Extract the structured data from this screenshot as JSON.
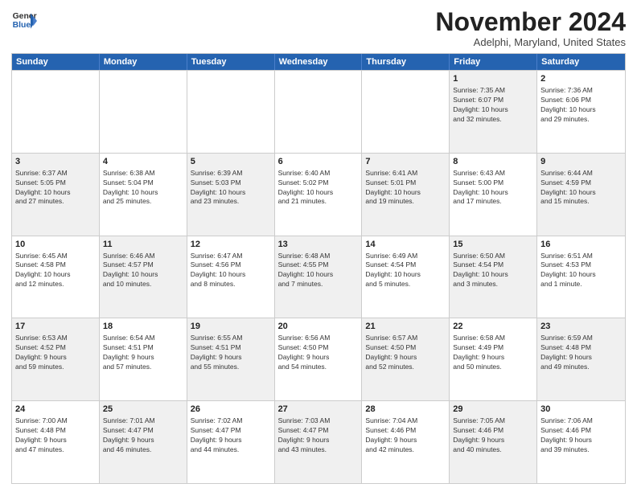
{
  "logo": {
    "general": "General",
    "blue": "Blue"
  },
  "header": {
    "month": "November 2024",
    "location": "Adelphi, Maryland, United States"
  },
  "weekdays": [
    "Sunday",
    "Monday",
    "Tuesday",
    "Wednesday",
    "Thursday",
    "Friday",
    "Saturday"
  ],
  "rows": [
    [
      {
        "day": "",
        "info": "",
        "shaded": false
      },
      {
        "day": "",
        "info": "",
        "shaded": false
      },
      {
        "day": "",
        "info": "",
        "shaded": false
      },
      {
        "day": "",
        "info": "",
        "shaded": false
      },
      {
        "day": "",
        "info": "",
        "shaded": false
      },
      {
        "day": "1",
        "info": "Sunrise: 7:35 AM\nSunset: 6:07 PM\nDaylight: 10 hours\nand 32 minutes.",
        "shaded": true
      },
      {
        "day": "2",
        "info": "Sunrise: 7:36 AM\nSunset: 6:06 PM\nDaylight: 10 hours\nand 29 minutes.",
        "shaded": false
      }
    ],
    [
      {
        "day": "3",
        "info": "Sunrise: 6:37 AM\nSunset: 5:05 PM\nDaylight: 10 hours\nand 27 minutes.",
        "shaded": true
      },
      {
        "day": "4",
        "info": "Sunrise: 6:38 AM\nSunset: 5:04 PM\nDaylight: 10 hours\nand 25 minutes.",
        "shaded": false
      },
      {
        "day": "5",
        "info": "Sunrise: 6:39 AM\nSunset: 5:03 PM\nDaylight: 10 hours\nand 23 minutes.",
        "shaded": true
      },
      {
        "day": "6",
        "info": "Sunrise: 6:40 AM\nSunset: 5:02 PM\nDaylight: 10 hours\nand 21 minutes.",
        "shaded": false
      },
      {
        "day": "7",
        "info": "Sunrise: 6:41 AM\nSunset: 5:01 PM\nDaylight: 10 hours\nand 19 minutes.",
        "shaded": true
      },
      {
        "day": "8",
        "info": "Sunrise: 6:43 AM\nSunset: 5:00 PM\nDaylight: 10 hours\nand 17 minutes.",
        "shaded": false
      },
      {
        "day": "9",
        "info": "Sunrise: 6:44 AM\nSunset: 4:59 PM\nDaylight: 10 hours\nand 15 minutes.",
        "shaded": true
      }
    ],
    [
      {
        "day": "10",
        "info": "Sunrise: 6:45 AM\nSunset: 4:58 PM\nDaylight: 10 hours\nand 12 minutes.",
        "shaded": false
      },
      {
        "day": "11",
        "info": "Sunrise: 6:46 AM\nSunset: 4:57 PM\nDaylight: 10 hours\nand 10 minutes.",
        "shaded": true
      },
      {
        "day": "12",
        "info": "Sunrise: 6:47 AM\nSunset: 4:56 PM\nDaylight: 10 hours\nand 8 minutes.",
        "shaded": false
      },
      {
        "day": "13",
        "info": "Sunrise: 6:48 AM\nSunset: 4:55 PM\nDaylight: 10 hours\nand 7 minutes.",
        "shaded": true
      },
      {
        "day": "14",
        "info": "Sunrise: 6:49 AM\nSunset: 4:54 PM\nDaylight: 10 hours\nand 5 minutes.",
        "shaded": false
      },
      {
        "day": "15",
        "info": "Sunrise: 6:50 AM\nSunset: 4:54 PM\nDaylight: 10 hours\nand 3 minutes.",
        "shaded": true
      },
      {
        "day": "16",
        "info": "Sunrise: 6:51 AM\nSunset: 4:53 PM\nDaylight: 10 hours\nand 1 minute.",
        "shaded": false
      }
    ],
    [
      {
        "day": "17",
        "info": "Sunrise: 6:53 AM\nSunset: 4:52 PM\nDaylight: 9 hours\nand 59 minutes.",
        "shaded": true
      },
      {
        "day": "18",
        "info": "Sunrise: 6:54 AM\nSunset: 4:51 PM\nDaylight: 9 hours\nand 57 minutes.",
        "shaded": false
      },
      {
        "day": "19",
        "info": "Sunrise: 6:55 AM\nSunset: 4:51 PM\nDaylight: 9 hours\nand 55 minutes.",
        "shaded": true
      },
      {
        "day": "20",
        "info": "Sunrise: 6:56 AM\nSunset: 4:50 PM\nDaylight: 9 hours\nand 54 minutes.",
        "shaded": false
      },
      {
        "day": "21",
        "info": "Sunrise: 6:57 AM\nSunset: 4:50 PM\nDaylight: 9 hours\nand 52 minutes.",
        "shaded": true
      },
      {
        "day": "22",
        "info": "Sunrise: 6:58 AM\nSunset: 4:49 PM\nDaylight: 9 hours\nand 50 minutes.",
        "shaded": false
      },
      {
        "day": "23",
        "info": "Sunrise: 6:59 AM\nSunset: 4:48 PM\nDaylight: 9 hours\nand 49 minutes.",
        "shaded": true
      }
    ],
    [
      {
        "day": "24",
        "info": "Sunrise: 7:00 AM\nSunset: 4:48 PM\nDaylight: 9 hours\nand 47 minutes.",
        "shaded": false
      },
      {
        "day": "25",
        "info": "Sunrise: 7:01 AM\nSunset: 4:47 PM\nDaylight: 9 hours\nand 46 minutes.",
        "shaded": true
      },
      {
        "day": "26",
        "info": "Sunrise: 7:02 AM\nSunset: 4:47 PM\nDaylight: 9 hours\nand 44 minutes.",
        "shaded": false
      },
      {
        "day": "27",
        "info": "Sunrise: 7:03 AM\nSunset: 4:47 PM\nDaylight: 9 hours\nand 43 minutes.",
        "shaded": true
      },
      {
        "day": "28",
        "info": "Sunrise: 7:04 AM\nSunset: 4:46 PM\nDaylight: 9 hours\nand 42 minutes.",
        "shaded": false
      },
      {
        "day": "29",
        "info": "Sunrise: 7:05 AM\nSunset: 4:46 PM\nDaylight: 9 hours\nand 40 minutes.",
        "shaded": true
      },
      {
        "day": "30",
        "info": "Sunrise: 7:06 AM\nSunset: 4:46 PM\nDaylight: 9 hours\nand 39 minutes.",
        "shaded": false
      }
    ]
  ]
}
